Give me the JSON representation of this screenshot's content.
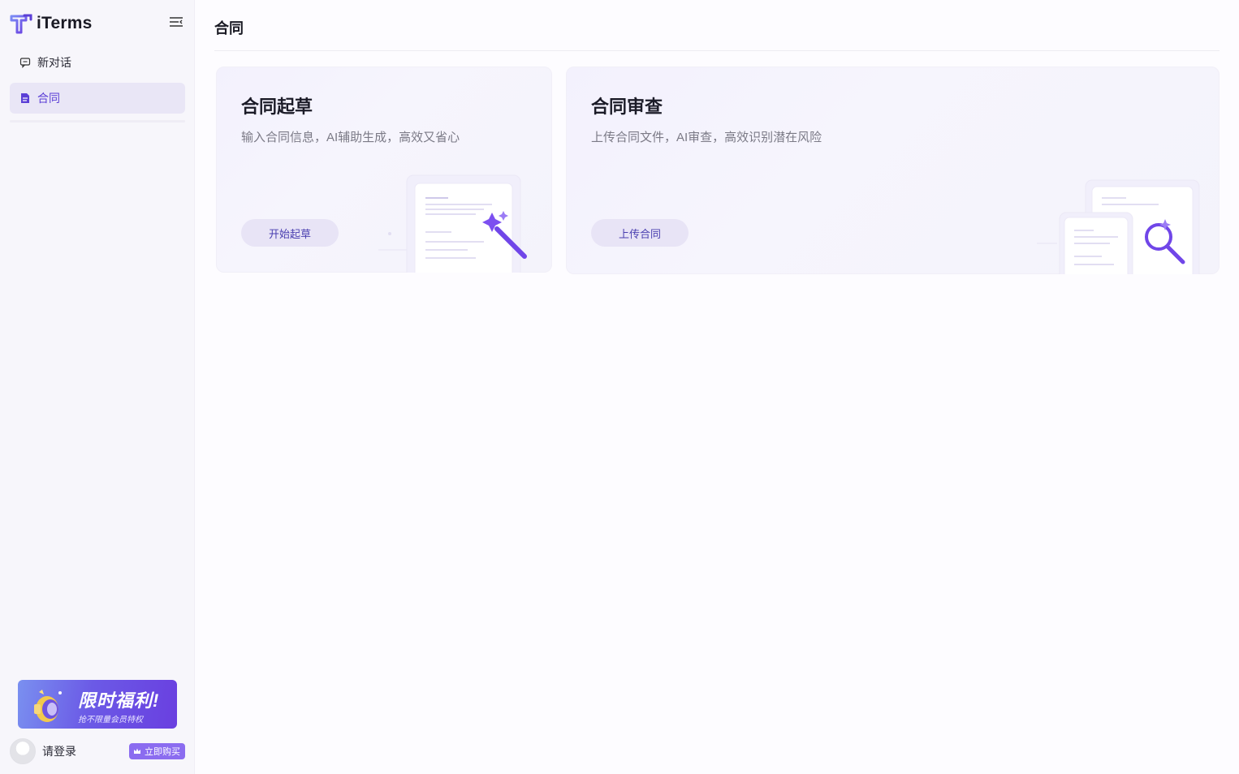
{
  "app": {
    "name": "iTerms"
  },
  "sidebar": {
    "items": [
      {
        "label": "新对话",
        "icon": "chat-icon"
      },
      {
        "label": "合同",
        "icon": "document-icon"
      }
    ],
    "promo": {
      "title": "限时福利!",
      "subtitle": "抢不限量会员特权",
      "icon": "megaphone-icon"
    },
    "user": {
      "login_label": "请登录",
      "buy_label": "立即购买",
      "buy_icon": "crown-icon"
    }
  },
  "main": {
    "title": "合同",
    "cards": [
      {
        "title": "合同起草",
        "description": "输入合同信息，AI辅助生成，高效又省心",
        "button": "开始起草",
        "illustration": "magic-wand-document-icon"
      },
      {
        "title": "合同审查",
        "description": "上传合同文件，AI审查，高效识别潜在风险",
        "button": "上传合同",
        "illustration": "magnifier-document-icon"
      }
    ]
  },
  "colors": {
    "accent": "#5b3fd6",
    "active_nav_bg": "#e9e6f6",
    "card_button_bg": "#e8e4f6",
    "promo_gradient_end": "#6a3fe0"
  }
}
